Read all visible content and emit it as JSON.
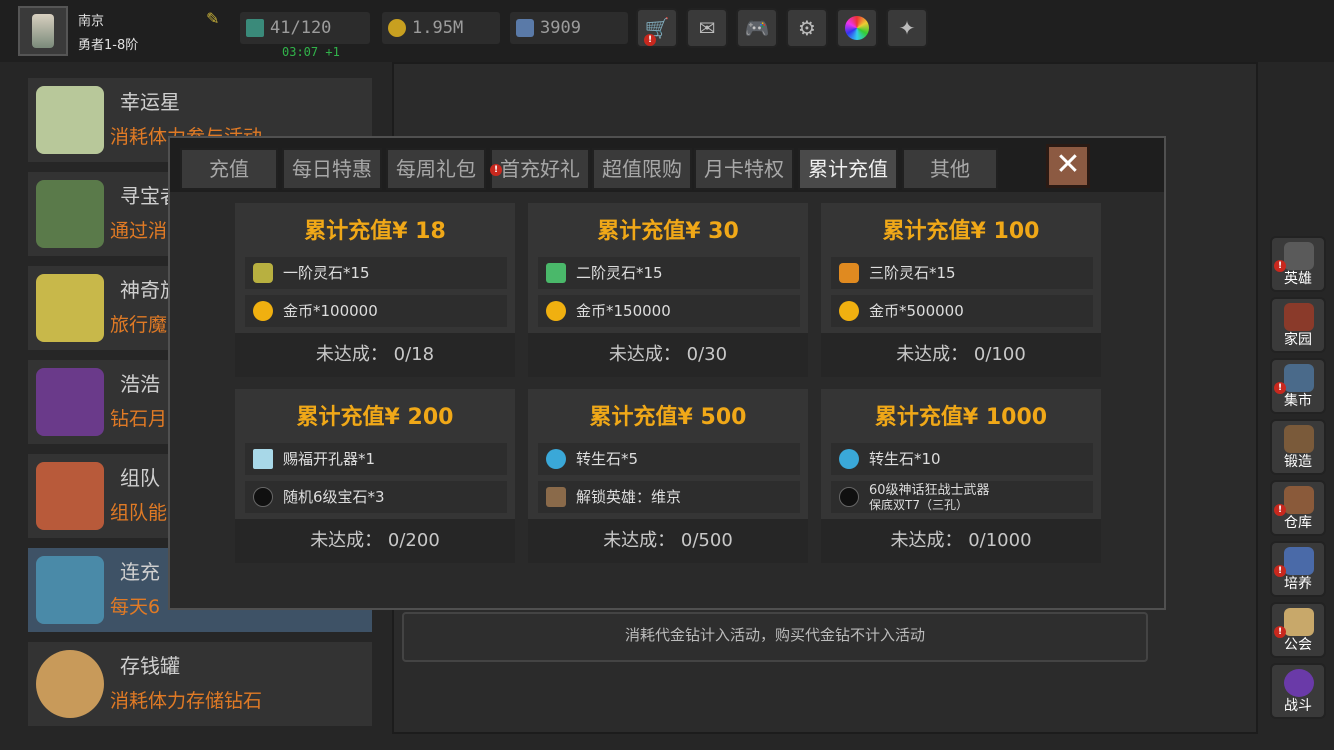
{
  "player": {
    "city": "南京",
    "rank": "勇者1-8阶"
  },
  "resources": {
    "stamina": "41/120",
    "gold": "1.95M",
    "diamonds": "3909",
    "timer": "03:07 +1"
  },
  "top_buttons": [
    {
      "icon": "shop-cart-icon"
    },
    {
      "icon": "mail-icon"
    },
    {
      "icon": "gamepad-icon"
    },
    {
      "icon": "gear-icon"
    },
    {
      "icon": "color-wheel-icon"
    },
    {
      "icon": "wing-icon"
    }
  ],
  "left_list": [
    {
      "title": "幸运星",
      "desc": "消耗体力参与活动",
      "color": "#b8c89a"
    },
    {
      "title": "寻宝者",
      "desc": "通过消",
      "color": "#5a7a4a"
    },
    {
      "title": "神奇旅",
      "desc": "旅行魔",
      "color": "#c8b84a"
    },
    {
      "title": "浩浩",
      "desc": "钻石月",
      "color": "#6a3a8a"
    },
    {
      "title": "组队",
      "desc": "组队能",
      "color": "#b85a3a"
    },
    {
      "title": "连充",
      "desc": "每天6",
      "color": "#4a8aa8"
    },
    {
      "title": "存钱罐",
      "desc": "消耗体力存储钻石",
      "color": "#c89a5a"
    }
  ],
  "note": "消耗代金钻计入活动，购买代金钻不计入活动",
  "tabs": [
    "充值",
    "每日特惠",
    "每周礼包",
    "首充好礼",
    "超值限购",
    "月卡特权",
    "累计充值",
    "其他"
  ],
  "active_tab": "累计充值",
  "cards": [
    {
      "title": "累计充值¥ 18",
      "items": [
        {
          "text": "一阶灵石*15",
          "color": "#b8b040"
        },
        {
          "text": "金币*100000",
          "color": "#f0b010"
        }
      ],
      "status": "未达成： 0/18"
    },
    {
      "title": "累计充值¥ 30",
      "items": [
        {
          "text": "二阶灵石*15",
          "color": "#4ab86a"
        },
        {
          "text": "金币*150000",
          "color": "#f0b010"
        }
      ],
      "status": "未达成： 0/30"
    },
    {
      "title": "累计充值¥ 100",
      "items": [
        {
          "text": "三阶灵石*15",
          "color": "#e08a20"
        },
        {
          "text": "金币*500000",
          "color": "#f0b010"
        }
      ],
      "status": "未达成： 0/100"
    },
    {
      "title": "累计充值¥ 200",
      "items": [
        {
          "text": "赐福开孔器*1",
          "color": "#a8d8e8"
        },
        {
          "text": "随机6级宝石*3",
          "color": "#101010"
        }
      ],
      "status": "未达成： 0/200"
    },
    {
      "title": "累计充值¥ 500",
      "items": [
        {
          "text": "转生石*5",
          "color": "#3aa8d8"
        },
        {
          "text": "解锁英雄：维京",
          "color": "#8a6a4a"
        }
      ],
      "status": "未达成： 0/500"
    },
    {
      "title": "累计充值¥ 1000",
      "items": [
        {
          "text": "转生石*10",
          "color": "#3aa8d8"
        },
        {
          "text": "60级神话狂战士武器",
          "sub": "保底双T7（三孔）",
          "color": "#101010"
        }
      ],
      "status": "未达成： 0/1000"
    }
  ],
  "right_menu": [
    {
      "label": "英雄",
      "color": "#5a5a5a",
      "badge": true
    },
    {
      "label": "家园",
      "color": "#8a3a2a",
      "badge": false
    },
    {
      "label": "集市",
      "color": "#4a6a8a",
      "badge": true
    },
    {
      "label": "锻造",
      "color": "#7a5a3a",
      "badge": false
    },
    {
      "label": "仓库",
      "color": "#8a5a3a",
      "badge": true
    },
    {
      "label": "培养",
      "color": "#4a6aa8",
      "badge": true
    },
    {
      "label": "公会",
      "color": "#c8a86a",
      "badge": true
    },
    {
      "label": "战斗",
      "color": "#6a3aa8",
      "badge": false
    }
  ],
  "colors": {
    "accent": "#f0a818",
    "desc": "#e07a25",
    "timer": "#31b34a",
    "badge": "#c8281e"
  }
}
